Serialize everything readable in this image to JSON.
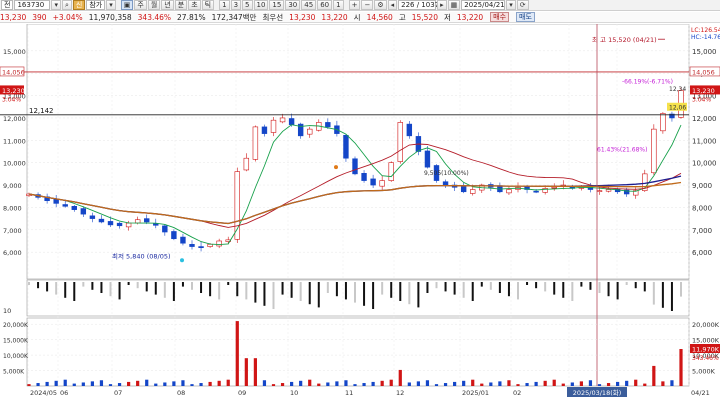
{
  "toolbar": {
    "code": "163730",
    "mode_label": "전",
    "group_label": "신",
    "chart_type_label": "참가",
    "periods": [
      "주",
      "월",
      "년",
      "분",
      "초",
      "틱"
    ],
    "intervals": [
      "1",
      "3",
      "5",
      "10",
      "15",
      "30",
      "45",
      "60",
      "1"
    ],
    "page_counter": "226 / 1037",
    "date": "2025/04/21",
    "buy_label": "매수",
    "sell_label": "매도"
  },
  "infobar": {
    "price": "13,230",
    "change": "390",
    "change_pct": "+3.04%",
    "volume": "11,970,358",
    "volume_pct": "343.46%",
    "turnover_rate": "27.81%",
    "amount": "172,347백만",
    "ask_label": "최우선",
    "ask_price": "13,230",
    "bid_price": "13,220",
    "open_label": "시",
    "open": "14,560",
    "high_label": "고",
    "high": "15,520",
    "low_label": "저",
    "low": "13,220",
    "buy_button": "매수",
    "sell_button": "매도"
  },
  "colors": {
    "up": "#d01515",
    "down": "#1446c8",
    "ma5": "#16a04a",
    "ma20": "#b51e2a",
    "ma60": "#1d1d8f",
    "ma120": "#c06a1a",
    "hline": "#c0282c",
    "cursor": "#b84a5a"
  },
  "price_panel": {
    "ylim": [
      4800,
      16200
    ],
    "y_ticks": [
      "15,000",
      "14,000",
      "13,000",
      "12,000",
      "11,000",
      "10,000",
      "9,000",
      "8,000",
      "7,000",
      "6,000"
    ],
    "left_ticks": [
      "15,000",
      "13,000",
      "12,000",
      "11,000",
      "10,000",
      "9,000",
      "8,000",
      "7,000",
      "6,000"
    ],
    "hline_price_label": "14,056",
    "hline_price": 14056,
    "current_price_label": "13,230",
    "current_price_pct": "3.04%",
    "current_price": 13230,
    "black_line_label": "12,142",
    "black_line": 12142,
    "right_top_labels": [
      "LC:126.54",
      "HC:-14.76"
    ],
    "annotations": {
      "high_text": "최 고 15,520 (04/21)",
      "low_text": "최저 5,840 (08/05)",
      "mid_text": "9,505(10.00%)",
      "pct_neg": "-66.19%(-6.71%)",
      "pct_pos": "61.43%(21.68%)",
      "small_label": "12,34",
      "small_label2": "12,06"
    }
  },
  "osc_panel": {
    "left_tick": "10"
  },
  "volume_panel": {
    "y_ticks": [
      "20,000K",
      "15,000K",
      "10,000K",
      "5,000K"
    ],
    "left_ticks": [
      "20,000K",
      "15,000K",
      "10,000K",
      "5,000K"
    ],
    "current_label": "11,970K",
    "current_pct": "343.46%"
  },
  "x_axis": {
    "labels": [
      "2024/05",
      "06",
      "07",
      "08",
      "09",
      "10",
      "11",
      "12",
      "2025/01",
      "02",
      "03",
      "04",
      "04/21"
    ],
    "cursor_date": "2025/03/18(화)"
  },
  "chart_data": {
    "type": "candlestick",
    "daily_close_series": [
      8600,
      8450,
      8300,
      8180,
      8050,
      7900,
      7700,
      7500,
      7350,
      7220,
      7180,
      7300,
      7450,
      7350,
      7200,
      6900,
      6600,
      6400,
      6250,
      6200,
      6350,
      6500,
      6550,
      9600,
      10200,
      11600,
      11300,
      11900,
      12000,
      11700,
      11200,
      11500,
      11800,
      11600,
      11300,
      10200,
      9500,
      9200,
      9000,
      9200,
      10000,
      11800,
      11200,
      10500,
      9800,
      9200,
      9000,
      8900,
      8700,
      8800,
      9000,
      8900,
      8700,
      8800,
      8900,
      8800,
      8700,
      8850,
      8900,
      9000,
      8850,
      8900,
      8800,
      8750,
      8800,
      8700,
      8600,
      8750,
      9500,
      11500,
      12200,
      12000,
      13230
    ],
    "ma_lines": [
      "MA5",
      "MA20",
      "MA60",
      "MA120"
    ]
  }
}
